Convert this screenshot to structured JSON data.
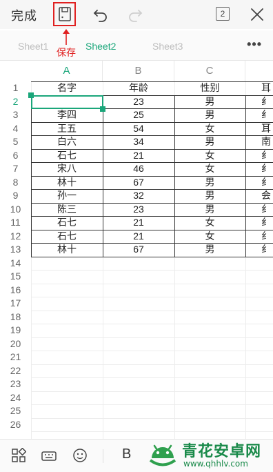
{
  "toolbar": {
    "done_label": "完成",
    "icons": [
      "save-icon",
      "undo-icon",
      "redo-icon",
      "sheet-count-icon",
      "close-icon"
    ],
    "sheet_count": "2"
  },
  "annotation": {
    "save_label": "保存"
  },
  "tabs": [
    {
      "label": "Sheet1",
      "active": false
    },
    {
      "label": "Sheet2",
      "active": true
    },
    {
      "label": "Sheet3",
      "active": false
    }
  ],
  "more_label": "•••",
  "grid": {
    "columns": [
      "A",
      "B",
      "C"
    ],
    "selected_column": "A",
    "selected_row": "2",
    "rows": [
      {
        "num": "1",
        "cells": [
          "名字",
          "年龄",
          "性别",
          "耳"
        ]
      },
      {
        "num": "2",
        "cells": [
          "",
          "23",
          "男",
          "纟"
        ]
      },
      {
        "num": "3",
        "cells": [
          "李四",
          "25",
          "男",
          "纟"
        ]
      },
      {
        "num": "4",
        "cells": [
          "王五",
          "54",
          "女",
          "耳"
        ]
      },
      {
        "num": "5",
        "cells": [
          "白六",
          "34",
          "男",
          "南"
        ]
      },
      {
        "num": "6",
        "cells": [
          "石七",
          "21",
          "女",
          "纟"
        ]
      },
      {
        "num": "7",
        "cells": [
          "宋八",
          "46",
          "女",
          "纟"
        ]
      },
      {
        "num": "8",
        "cells": [
          "林十",
          "67",
          "男",
          "纟"
        ]
      },
      {
        "num": "9",
        "cells": [
          "孙一",
          "32",
          "男",
          "会"
        ]
      },
      {
        "num": "10",
        "cells": [
          "陈三",
          "23",
          "男",
          "纟"
        ]
      },
      {
        "num": "11",
        "cells": [
          "石七",
          "21",
          "女",
          "纟"
        ]
      },
      {
        "num": "12",
        "cells": [
          "石七",
          "21",
          "女",
          "纟"
        ]
      },
      {
        "num": "13",
        "cells": [
          "林十",
          "67",
          "男",
          "纟"
        ]
      },
      {
        "num": "14",
        "cells": [
          "",
          "",
          "",
          ""
        ]
      },
      {
        "num": "15",
        "cells": [
          "",
          "",
          "",
          ""
        ]
      },
      {
        "num": "16",
        "cells": [
          "",
          "",
          "",
          ""
        ]
      },
      {
        "num": "17",
        "cells": [
          "",
          "",
          "",
          ""
        ]
      },
      {
        "num": "18",
        "cells": [
          "",
          "",
          "",
          ""
        ]
      },
      {
        "num": "19",
        "cells": [
          "",
          "",
          "",
          ""
        ]
      },
      {
        "num": "20",
        "cells": [
          "",
          "",
          "",
          ""
        ]
      },
      {
        "num": "21",
        "cells": [
          "",
          "",
          "",
          ""
        ]
      },
      {
        "num": "22",
        "cells": [
          "",
          "",
          "",
          ""
        ]
      },
      {
        "num": "23",
        "cells": [
          "",
          "",
          "",
          ""
        ]
      },
      {
        "num": "24",
        "cells": [
          "",
          "",
          "",
          ""
        ]
      },
      {
        "num": "25",
        "cells": [
          "",
          "",
          "",
          ""
        ]
      },
      {
        "num": "26",
        "cells": [
          "",
          "",
          "",
          ""
        ]
      }
    ]
  },
  "bottombar": {
    "icons": [
      "apps-icon",
      "keyboard-icon",
      "emoji-icon"
    ],
    "bold_label": "B"
  },
  "watermark": {
    "title": "青花安卓网",
    "url": "www.qhhlv.com"
  },
  "colors": {
    "accent": "#1aa67a",
    "annotation": "#e02020",
    "watermark": "#1a8a4a"
  }
}
